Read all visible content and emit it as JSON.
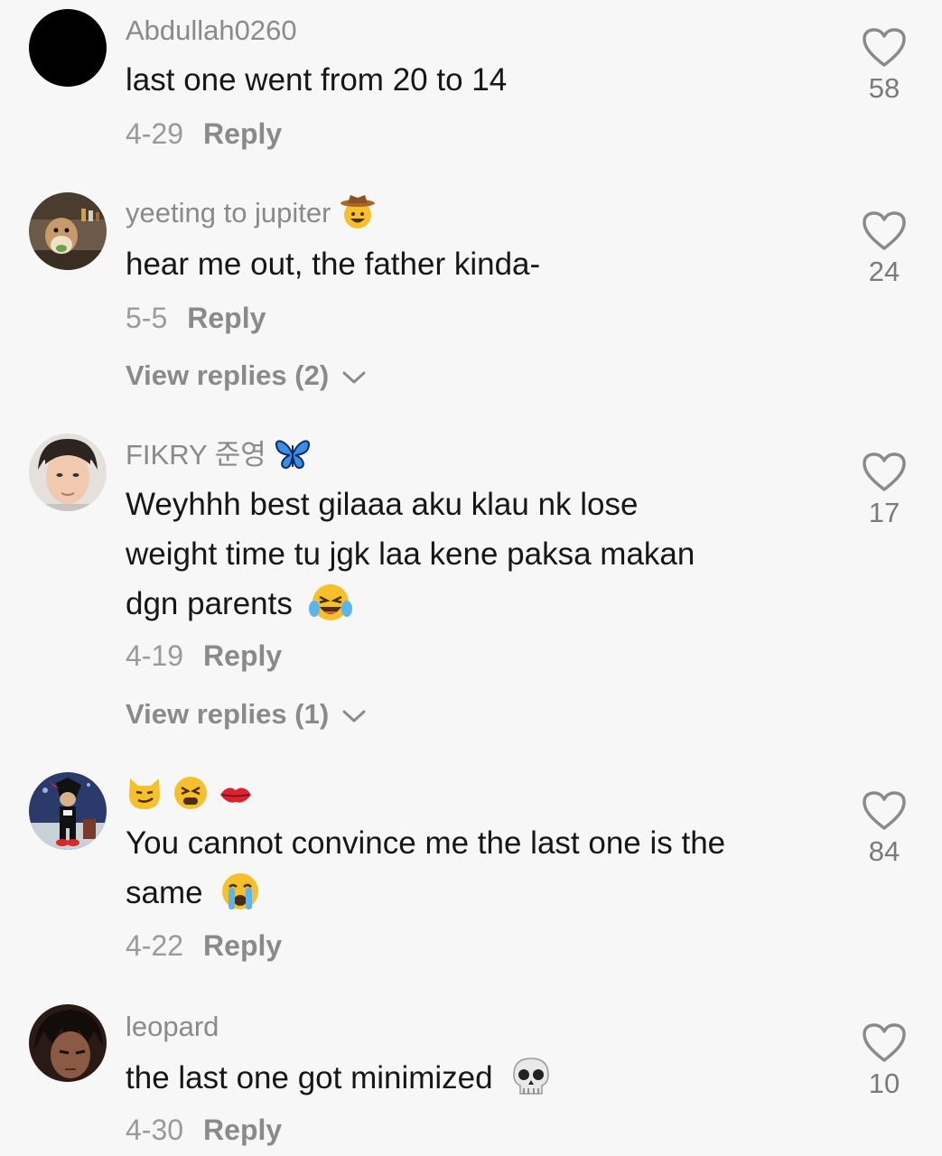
{
  "colors": {
    "background": "#f7f7f7",
    "text": "#161616",
    "muted": "#8a8a8a",
    "heart": "#8a8a8a"
  },
  "comments": [
    {
      "username": "Abdullah0260",
      "text": "last one went from 20 to 14",
      "date": "4-29",
      "reply_label": "Reply",
      "likes": "58"
    },
    {
      "username": "yeeting to jupiter",
      "username_emoji": "cowboy-emoji",
      "text": "hear me out, the father kinda-",
      "date": "5-5",
      "reply_label": "Reply",
      "likes": "24",
      "view_replies": "View replies (2)"
    },
    {
      "username": "FIKRY 준영",
      "username_emoji": "butterfly-emoji",
      "text_lines": [
        "Weyhhh best gilaaa aku klau nk lose",
        "weight time tu jgk laa kene paksa makan",
        "dgn parents"
      ],
      "text_emoji": "laughing-tears-emoji",
      "date": "4-19",
      "reply_label": "Reply",
      "likes": "17",
      "view_replies": "View replies (1)"
    },
    {
      "username_emojis": [
        "smirk-cat-emoji",
        "tired-face-emoji",
        "kiss-mark-emoji"
      ],
      "text_lines": [
        "You cannot convince me the last one is the",
        "same"
      ],
      "text_emoji": "crying-emoji",
      "date": "4-22",
      "reply_label": "Reply",
      "likes": "84"
    },
    {
      "username": "leopard",
      "text": "the last one got minimized",
      "text_emoji": "skull-emoji",
      "date": "4-30",
      "reply_label": "Reply",
      "likes": "10"
    }
  ]
}
